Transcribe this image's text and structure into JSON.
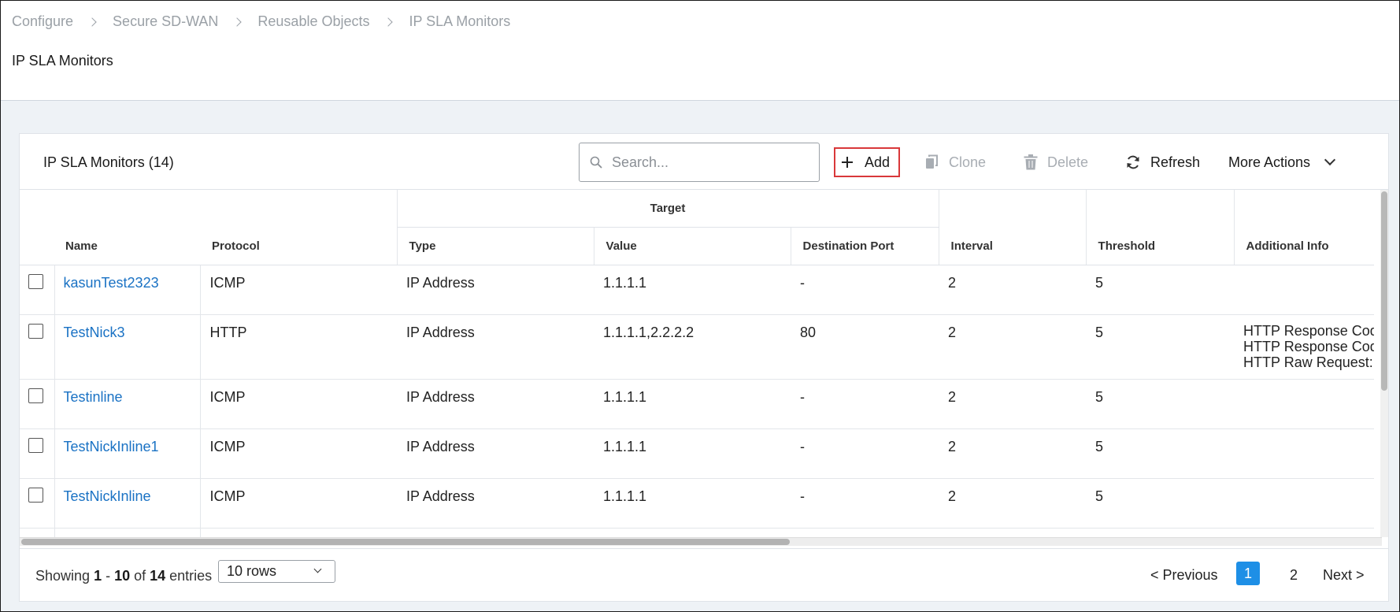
{
  "breadcrumb": [
    "Configure",
    "Secure SD-WAN",
    "Reusable Objects",
    "IP SLA Monitors"
  ],
  "page_title": "IP SLA Monitors",
  "card": {
    "title": "IP SLA Monitors (14)",
    "search_placeholder": "Search...",
    "buttons": {
      "add": "Add",
      "clone": "Clone",
      "delete": "Delete",
      "refresh": "Refresh",
      "more_actions": "More Actions"
    }
  },
  "table": {
    "headers": {
      "name": "Name",
      "protocol": "Protocol",
      "target_group": "Target",
      "type": "Type",
      "value": "Value",
      "destination_port": "Destination Port",
      "interval": "Interval",
      "threshold": "Threshold",
      "additional_info": "Additional Info"
    },
    "rows": [
      {
        "name": "kasunTest2323",
        "protocol": "ICMP",
        "type": "IP Address",
        "value": "1.1.1.1",
        "port": "-",
        "interval": "2",
        "threshold": "5",
        "info": []
      },
      {
        "name": "TestNick3",
        "protocol": "HTTP",
        "type": "IP Address",
        "value": "1.1.1.1,2.2.2.2",
        "port": "80",
        "interval": "2",
        "threshold": "5",
        "info": [
          "HTTP Response Code I",
          "HTTP Response Code I",
          "HTTP Raw Request:  P"
        ]
      },
      {
        "name": "Testinline",
        "protocol": "ICMP",
        "type": "IP Address",
        "value": "1.1.1.1",
        "port": "-",
        "interval": "2",
        "threshold": "5",
        "info": []
      },
      {
        "name": "TestNickInline1",
        "protocol": "ICMP",
        "type": "IP Address",
        "value": "1.1.1.1",
        "port": "-",
        "interval": "2",
        "threshold": "5",
        "info": []
      },
      {
        "name": "TestNickInline",
        "protocol": "ICMP",
        "type": "IP Address",
        "value": "1.1.1.1",
        "port": "-",
        "interval": "2",
        "threshold": "5",
        "info": []
      }
    ]
  },
  "footer": {
    "showing_prefix": "Showing ",
    "range_start": "1",
    "range_sep": " - ",
    "range_end": "10",
    "of_text": " of ",
    "total": "14",
    "entries_text": " entries",
    "rows_select": "10 rows",
    "prev": "< Previous",
    "pages": [
      "1",
      "2"
    ],
    "current_page": "1",
    "next": "Next >"
  },
  "colors": {
    "link": "#1a72c4",
    "add_border": "#d9383a",
    "active_page": "#1e8fe6",
    "disabled": "#a8adb3"
  }
}
